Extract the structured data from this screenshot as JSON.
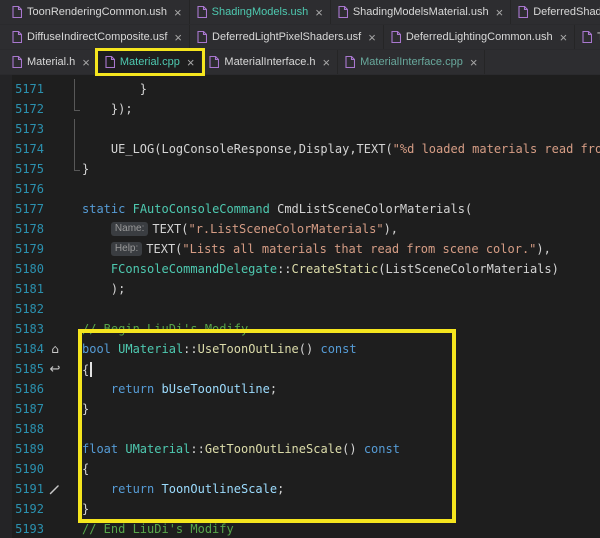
{
  "colors": {
    "highlight_yellow": "#F5E51E",
    "line_number": "#2B91AF",
    "keyword": "#569CD6",
    "type": "#4EC9B0",
    "function": "#DCDCAA",
    "variable": "#9CDCFE",
    "string": "#D69D85",
    "comment": "#57A64A"
  },
  "close_glyph": "×",
  "tab_rows": [
    {
      "tabs": [
        {
          "label": "ToonRenderingCommon.ush",
          "style": "light"
        },
        {
          "label": "ShadingModels.ush",
          "style": "teal"
        },
        {
          "label": "ShadingModelsMaterial.ush",
          "style": "light"
        },
        {
          "label": "DeferredShading",
          "style": "light"
        }
      ]
    },
    {
      "tabs": [
        {
          "label": "DiffuseIndirectComposite.usf",
          "style": "light"
        },
        {
          "label": "DeferredLightPixelShaders.usf",
          "style": "light"
        },
        {
          "label": "DeferredLightingCommon.ush",
          "style": "light"
        },
        {
          "label": "Toon",
          "style": "light"
        }
      ]
    },
    {
      "tabs": [
        {
          "label": "Material.h",
          "style": "light"
        },
        {
          "label": "Material.cpp",
          "style": "teal",
          "active": true
        },
        {
          "label": "MaterialInterface.h",
          "style": "light"
        },
        {
          "label": "MaterialInterface.cpp",
          "style": "teal-dim"
        }
      ]
    }
  ],
  "editor": {
    "lines": [
      {
        "n": "5171",
        "segs": [
          [
            "p",
            "\t\t}"
          ]
        ],
        "fold": "v"
      },
      {
        "n": "5172",
        "segs": [
          [
            "p",
            "\t});"
          ]
        ],
        "fold": "e"
      },
      {
        "n": "5173",
        "segs": [],
        "fold": "v"
      },
      {
        "n": "5174",
        "segs": [
          [
            "p",
            "\tUE_LOG(LogConsoleResponse,Display,TEXT("
          ],
          [
            "s",
            "\"%d loaded materials read from sce"
          ]
        ],
        "fold": "v"
      },
      {
        "n": "5175",
        "segs": [
          [
            "p",
            "}"
          ]
        ],
        "fold": "e"
      },
      {
        "n": "5176",
        "segs": []
      },
      {
        "n": "5177",
        "segs": [
          [
            "k",
            "static"
          ],
          [
            "p",
            " "
          ],
          [
            "t",
            "FAutoConsoleCommand"
          ],
          [
            "p",
            " CmdListSceneColorMaterials("
          ]
        ]
      },
      {
        "n": "5178",
        "segs": [
          [
            "p",
            "\t"
          ],
          [
            "h",
            "Name:"
          ],
          [
            "p",
            "TEXT("
          ],
          [
            "s",
            "\"r.ListSceneColorMaterials\""
          ],
          [
            "p",
            "),"
          ]
        ]
      },
      {
        "n": "5179",
        "segs": [
          [
            "p",
            "\t"
          ],
          [
            "h",
            "Help:"
          ],
          [
            "p",
            "TEXT("
          ],
          [
            "s",
            "\"Lists all materials that read from scene color.\""
          ],
          [
            "p",
            "),"
          ]
        ]
      },
      {
        "n": "5180",
        "segs": [
          [
            "p",
            "\t"
          ],
          [
            "t",
            "FConsoleCommandDelegate"
          ],
          [
            "p",
            "::"
          ],
          [
            "f",
            "CreateStatic"
          ],
          [
            "p",
            "(ListSceneColorMaterials)"
          ]
        ]
      },
      {
        "n": "5181",
        "segs": [
          [
            "p",
            "\t);"
          ]
        ]
      },
      {
        "n": "5182",
        "segs": []
      },
      {
        "n": "5183",
        "segs": [
          [
            "c",
            "// Begin LiuDi's Modify"
          ]
        ]
      },
      {
        "n": "5184",
        "segs": [
          [
            "k",
            "bool"
          ],
          [
            "p",
            " "
          ],
          [
            "t",
            "UMaterial"
          ],
          [
            "p",
            "::"
          ],
          [
            "f",
            "UseToonOutLine",
            "sq"
          ],
          [
            "p",
            "() "
          ],
          [
            "k",
            "const"
          ]
        ],
        "glyph": "home-icon"
      },
      {
        "n": "5185",
        "segs": [
          [
            "p",
            "{"
          ]
        ],
        "glyph": "back-arrow-icon",
        "caret": true
      },
      {
        "n": "5186",
        "segs": [
          [
            "p",
            "\t"
          ],
          [
            "k",
            "return"
          ],
          [
            "p",
            " "
          ],
          [
            "v",
            "bUseToonOutline",
            "sq"
          ],
          [
            "p",
            ";"
          ]
        ]
      },
      {
        "n": "5187",
        "segs": [
          [
            "p",
            "}"
          ]
        ]
      },
      {
        "n": "5188",
        "segs": []
      },
      {
        "n": "5189",
        "segs": [
          [
            "k",
            "float"
          ],
          [
            "p",
            " "
          ],
          [
            "t",
            "UMaterial"
          ],
          [
            "p",
            "::"
          ],
          [
            "f",
            "GetToonOutLineScale",
            "sq"
          ],
          [
            "p",
            "() "
          ],
          [
            "k",
            "const"
          ]
        ]
      },
      {
        "n": "5190",
        "segs": [
          [
            "p",
            "{"
          ]
        ]
      },
      {
        "n": "5191",
        "segs": [
          [
            "p",
            "\t"
          ],
          [
            "k",
            "return"
          ],
          [
            "p",
            " "
          ],
          [
            "v",
            "ToonOutlineScale",
            "sq"
          ],
          [
            "p",
            ";"
          ]
        ],
        "glyph": "screwdriver-icon"
      },
      {
        "n": "5192",
        "segs": [
          [
            "p",
            "}"
          ]
        ]
      },
      {
        "n": "5193",
        "segs": [
          [
            "c",
            "// End LiuDi's Modify"
          ]
        ]
      }
    ]
  },
  "annotations": {
    "tab_highlight_target": "Material.cpp",
    "code_highlight_lines": [
      "5184",
      "5192"
    ]
  }
}
